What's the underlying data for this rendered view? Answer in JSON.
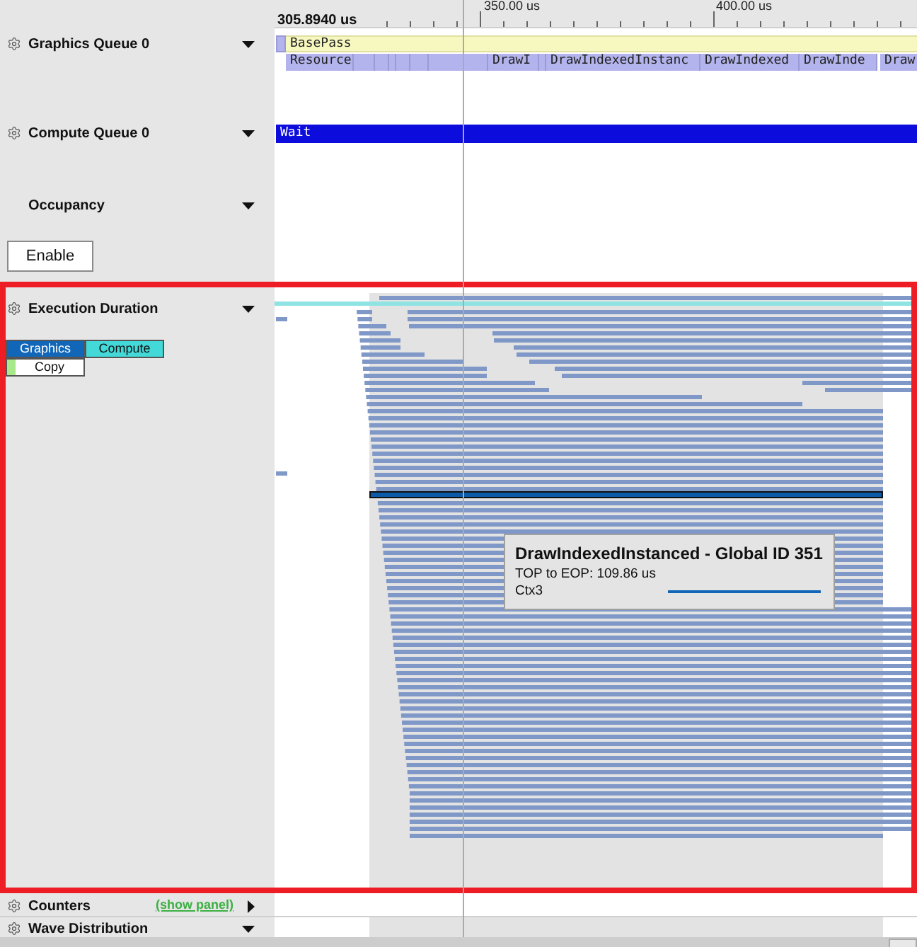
{
  "ruler": {
    "start": "305.8940 us",
    "marks": [
      "350.00 us",
      "400.00 us"
    ]
  },
  "graphics_queue": {
    "title": "Graphics Queue 0",
    "expanded": true,
    "lanes": [
      {
        "events": [
          {
            "label": "BasePass"
          }
        ]
      },
      {
        "events": [
          {
            "label": "Resource"
          },
          {
            "label": "DrawI"
          },
          {
            "label": "DrawIndexedInstanc"
          },
          {
            "label": "DrawIndexed"
          },
          {
            "label": "DrawInde"
          },
          {
            "label": "Draw"
          }
        ]
      }
    ]
  },
  "compute_queue": {
    "title": "Compute Queue 0",
    "expanded": true,
    "events": [
      {
        "label": "Wait"
      }
    ]
  },
  "occupancy": {
    "title": "Occupancy",
    "expanded": true,
    "button": "Enable"
  },
  "execution_duration": {
    "title": "Execution Duration",
    "expanded": true,
    "legend": [
      {
        "label": "Graphics",
        "color": "#1166b8",
        "kind": "filled"
      },
      {
        "label": "Compute",
        "color": "#44d9d9",
        "kind": "filled"
      },
      {
        "label": "Copy",
        "color": "#a8e88a",
        "kind": "swatch"
      }
    ],
    "tooltip": {
      "title": "DrawIndexedInstanced - Global ID 351",
      "lines": [
        "TOP to EOP: 109.86 us",
        "Ctx3"
      ]
    }
  },
  "counters": {
    "title": "Counters",
    "expanded": false,
    "link": "(show panel)"
  },
  "wave_distribution": {
    "title": "Wave Distribution",
    "expanded": true
  }
}
